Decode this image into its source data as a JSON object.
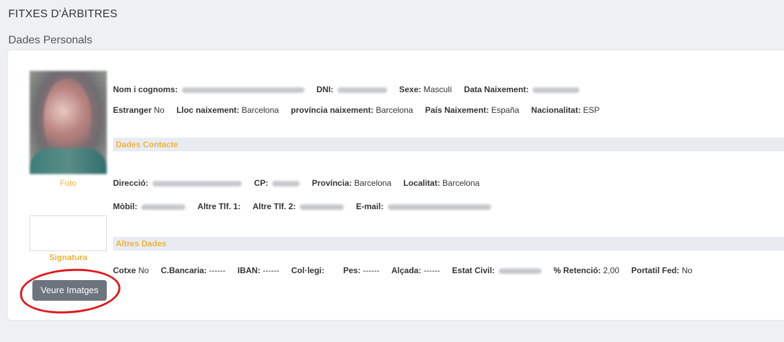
{
  "page": {
    "title": "FITXES D'ÀRBITRES",
    "section": "Dades Personals"
  },
  "sidebar": {
    "photo_label": "Foto",
    "signature_label": "Signatura",
    "button_label": "Veure Imatges"
  },
  "personal": {
    "name_label": "Nom i cognoms:",
    "dni_label": "DNI:",
    "sexe_label": "Sexe:",
    "sexe_value": "Masculí",
    "birth_label": "Data Naixement:",
    "foreign_label": "Estranger",
    "foreign_value": "No",
    "birthplace_label": "Lloc naixement:",
    "birthplace_value": "Barcelona",
    "birthprov_label": "província naixement:",
    "birthprov_value": "Barcelona",
    "birthcountry_label": "País Naixement:",
    "birthcountry_value": "España",
    "nationality_label": "Nacionalitat:",
    "nationality_value": "ESP"
  },
  "contact": {
    "heading": "Dades Contacte",
    "address_label": "Direcció:",
    "cp_label": "CP:",
    "province_label": "Província:",
    "province_value": "Barcelona",
    "locality_label": "Localitat:",
    "locality_value": "Barcelona",
    "mobile_label": "Mòbil:",
    "phone1_label": "Altre Tlf. 1:",
    "phone2_label": "Altre Tlf. 2:",
    "email_label": "E-mail:"
  },
  "other": {
    "heading": "Altres Dades",
    "car_label": "Cotxe",
    "car_value": "No",
    "bank_label": "C.Bancaria:",
    "bank_value": "------",
    "iban_label": "IBAN:",
    "iban_value": "------",
    "college_label": "Col·legi:",
    "weight_label": "Pes:",
    "weight_value": "------",
    "height_label": "Alçada:",
    "height_value": "------",
    "civil_label": "Estat Civil:",
    "retention_label": "% Retenció:",
    "retention_value": "2,00",
    "portable_label": "Portatil Fed:",
    "portable_value": "No"
  }
}
